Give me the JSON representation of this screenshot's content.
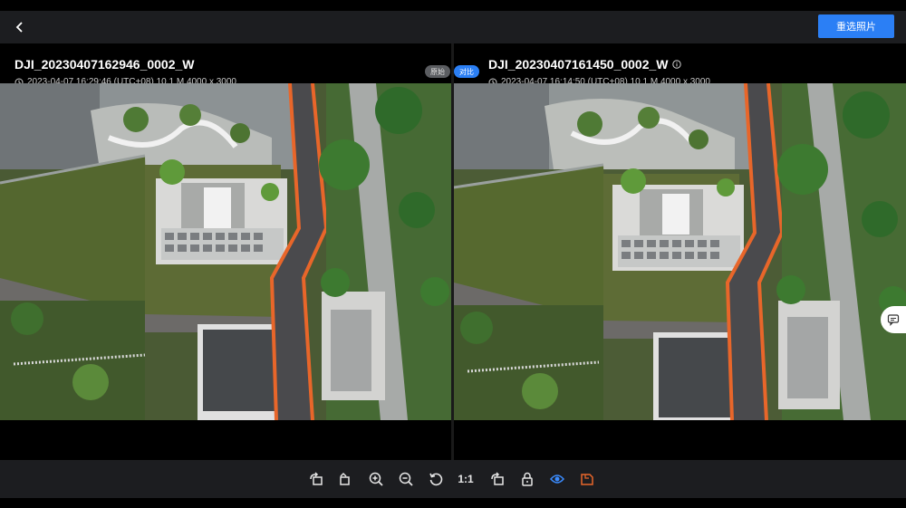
{
  "header": {
    "back_icon": "chevron-left-icon",
    "reselect_label": "重选照片"
  },
  "left_pane": {
    "filename": "DJI_20230407162946_0002_W",
    "meta": "2023-04-07 16:29:46 (UTC+08) 10.1 M 4000 x 3000",
    "badge": "原始"
  },
  "right_pane": {
    "filename": "DJI_20230407161450_0002_W",
    "meta": "2023-04-07 16:14:50 (UTC+08) 10.1 M 4000 x 3000",
    "badge": "对比"
  },
  "toolbar": {
    "actual_size_label": "1:1",
    "tools": [
      "rotate-left-icon",
      "rotate-right-icon",
      "zoom-in-icon",
      "zoom-out-icon",
      "reset-icon",
      "actual-size",
      "fit-icon",
      "lock-icon",
      "eye-icon",
      "draw-icon"
    ]
  },
  "colors": {
    "accent": "#2b7ff5",
    "orange_tool": "#e8662a",
    "blue_tool": "#3b8cff",
    "bar_bg": "#1c1d20"
  }
}
